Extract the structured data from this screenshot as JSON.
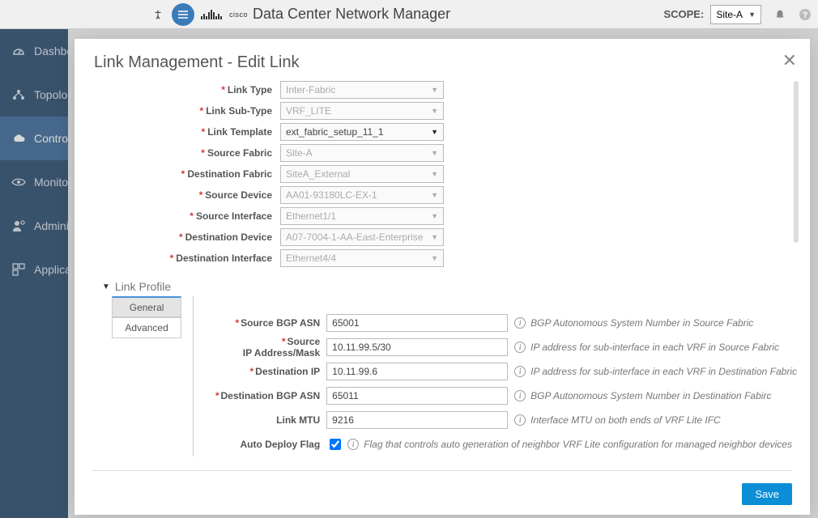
{
  "header": {
    "scope_label": "SCOPE:",
    "scope_value": "Site-A",
    "app_title": "Data Center Network Manager",
    "cisco": "cisco"
  },
  "sidebar": {
    "items": [
      {
        "label": "Dashboard",
        "icon": "gauge-icon",
        "active": false
      },
      {
        "label": "Topology",
        "icon": "topology-icon",
        "active": false
      },
      {
        "label": "Control",
        "icon": "cloud-icon",
        "active": true
      },
      {
        "label": "Monitor",
        "icon": "eye-icon",
        "active": false
      },
      {
        "label": "Administration",
        "icon": "user-gear-icon",
        "active": false
      },
      {
        "label": "Applications",
        "icon": "apps-icon",
        "active": false
      }
    ]
  },
  "modal": {
    "title": "Link Management - Edit Link",
    "form": {
      "link_type": {
        "label": "Link Type",
        "value": "Inter-Fabric"
      },
      "link_sub_type": {
        "label": "Link Sub-Type",
        "value": "VRF_LITE"
      },
      "link_template": {
        "label": "Link Template",
        "value": "ext_fabric_setup_11_1"
      },
      "source_fabric": {
        "label": "Source Fabric",
        "value": "Site-A"
      },
      "destination_fabric": {
        "label": "Destination Fabric",
        "value": "SiteA_External"
      },
      "source_device": {
        "label": "Source Device",
        "value": "AA01-93180LC-EX-1"
      },
      "source_interface": {
        "label": "Source Interface",
        "value": "Ethernet1/1"
      },
      "destination_device": {
        "label": "Destination Device",
        "value": "A07-7004-1-AA-East-Enterprise"
      },
      "destination_interface": {
        "label": "Destination Interface",
        "value": "Ethernet4/4"
      }
    },
    "link_profile": {
      "title": "Link Profile",
      "tabs": {
        "general": "General",
        "advanced": "Advanced"
      },
      "fields": {
        "source_bgp_asn": {
          "label": "Source BGP ASN",
          "value": "65001",
          "help": "BGP Autonomous System Number in Source Fabric"
        },
        "source_ip_mask": {
          "label": "Source\nIP Address/Mask",
          "value": "10.11.99.5/30",
          "help": "IP address for sub-interface in each VRF in Source Fabric"
        },
        "destination_ip": {
          "label": "Destination IP",
          "value": "10.11.99.6",
          "help": "IP address for sub-interface in each VRF in Destination Fabric"
        },
        "destination_bgp_asn": {
          "label": "Destination BGP ASN",
          "value": "65011",
          "help": "BGP Autonomous System Number in Destination Fabirc"
        },
        "link_mtu": {
          "label": "Link MTU",
          "value": "9216",
          "help": "Interface MTU on both ends of VRF Lite IFC"
        },
        "auto_deploy": {
          "label": "Auto Deploy Flag",
          "checked": true,
          "help": "Flag that controls auto generation of neighbor VRF Lite configuration for managed neighbor devices"
        }
      }
    },
    "save_label": "Save"
  }
}
